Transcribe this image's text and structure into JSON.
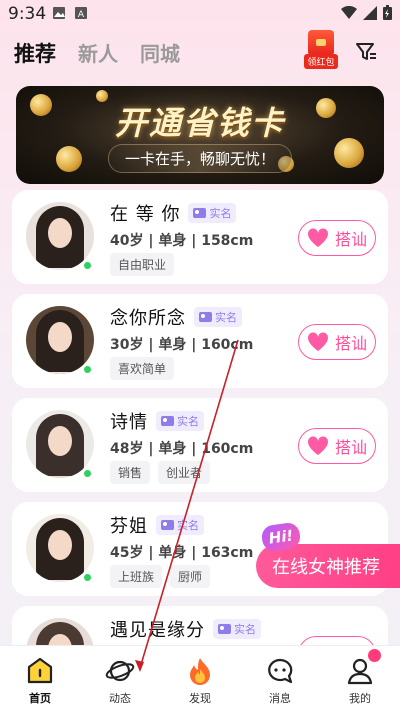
{
  "status_bar": {
    "time": "9:34"
  },
  "top_tabs": [
    {
      "label": "推荐",
      "active": true
    },
    {
      "label": "新人",
      "active": false
    },
    {
      "label": "同城",
      "active": false
    }
  ],
  "red_packet": {
    "label": "领红包"
  },
  "banner": {
    "title": "开通省钱卡",
    "subtitle": "一卡在手，畅聊无忧！"
  },
  "verified_label": "实名",
  "chat_button_label": "搭讪",
  "users": [
    {
      "name": "在 等 你",
      "info": "40岁 | 单身 | 158cm",
      "tags": [
        "自由职业"
      ]
    },
    {
      "name": "念你所念",
      "info": "30岁 | 单身 | 160cm",
      "tags": [
        "喜欢简单"
      ]
    },
    {
      "name": "诗情",
      "info": "48岁 | 单身 | 160cm",
      "tags": [
        "销售",
        "创业者"
      ]
    },
    {
      "name": "芬姐",
      "info": "45岁 | 单身 | 163cm",
      "tags": [
        "上班族",
        "厨师"
      ]
    },
    {
      "name": "遇见是缘分",
      "info": "",
      "tags": []
    }
  ],
  "floating": {
    "hi": "Hi!",
    "label": "在线女神推荐"
  },
  "bottom_nav": [
    {
      "label": "首页",
      "icon": "home-icon",
      "active": true
    },
    {
      "label": "动态",
      "icon": "planet-icon",
      "active": false
    },
    {
      "label": "发现",
      "icon": "flame-icon",
      "active": false
    },
    {
      "label": "消息",
      "icon": "message-icon",
      "active": false
    },
    {
      "label": "我的",
      "icon": "profile-icon",
      "active": false
    }
  ],
  "colors": {
    "accent": "#ff4b9a",
    "online": "#2bd25f",
    "verified": "#8e7ce8"
  }
}
